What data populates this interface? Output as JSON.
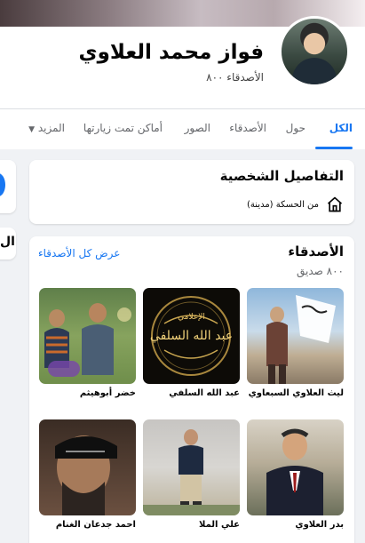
{
  "profile": {
    "name": "فواز محمد العلاوي",
    "friends_count": "الأصدقاء ٨٠٠"
  },
  "tabs": [
    {
      "label": "الكل",
      "active": true
    },
    {
      "label": "حول"
    },
    {
      "label": "الأصدقاء"
    },
    {
      "label": "الصور"
    },
    {
      "label": "أماكن تمت زيارتها"
    },
    {
      "label": "المزيد"
    }
  ],
  "details": {
    "title": "التفاصيل الشخصية",
    "hometown": "من الحسكة (مدينة)"
  },
  "friends": {
    "title": "الأصدقاء",
    "count": "٨٠٠ صديق",
    "see_all": "عرض كل الأصدقاء",
    "list": [
      {
        "name": "ليث العلاوي السبعاوي"
      },
      {
        "name": "عبد الله السلفي"
      },
      {
        "name": "خضر أبوهيثم"
      },
      {
        "name": "بدر العلاوي"
      },
      {
        "name": "علي الملا"
      },
      {
        "name": "احمد جدعان الغنام"
      }
    ],
    "photo_text": {
      "top": "الإعلامي",
      "main": "عبد الله السلفي"
    }
  },
  "side": {
    "partial_letter": "ال"
  },
  "icons": [
    "home-icon",
    "caret-down-icon"
  ],
  "colors": {
    "accent": "#1877f2",
    "background": "#f0f2f5",
    "muted": "#65676b"
  }
}
